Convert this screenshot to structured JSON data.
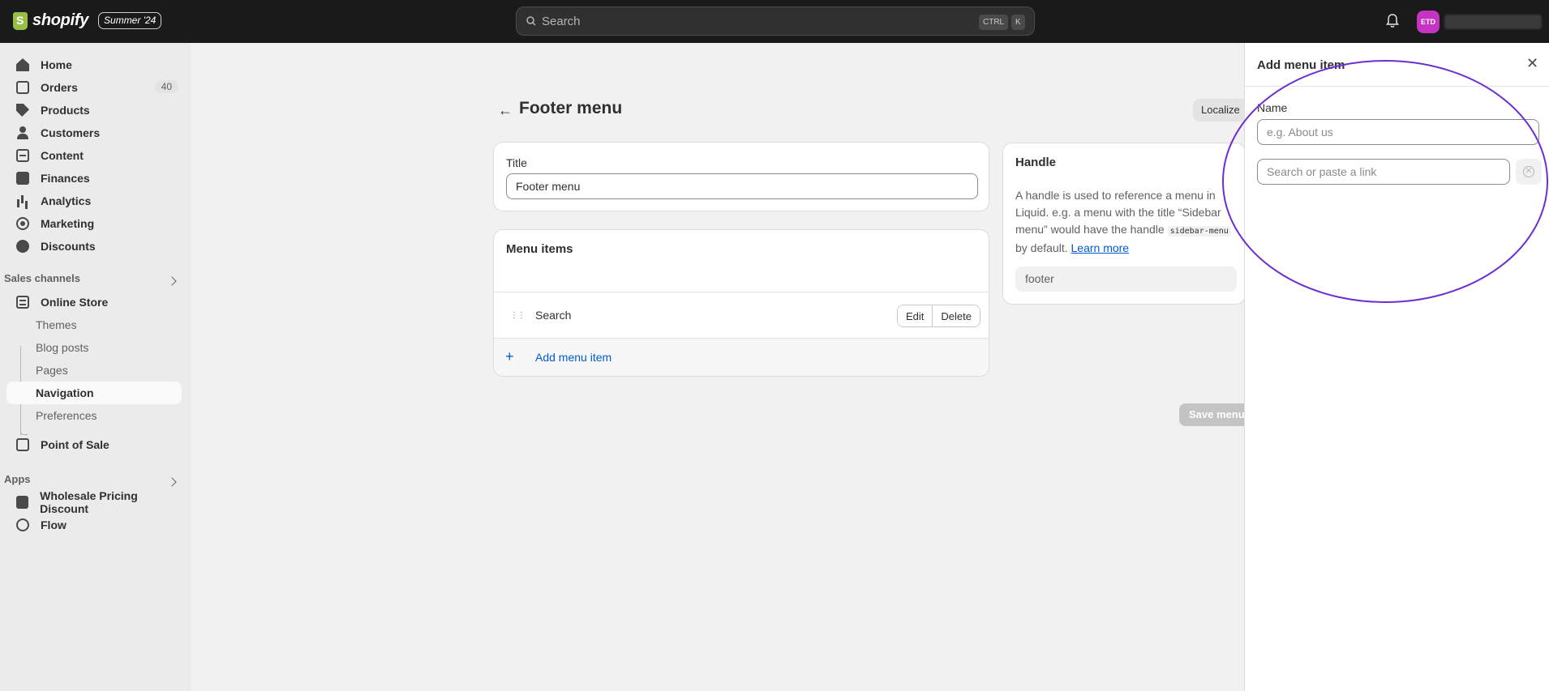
{
  "app": {
    "logo_text": "shopify",
    "edition_badge": "Summer '24"
  },
  "topbar": {
    "search_placeholder": "Search",
    "shortcut_ctrl": "CTRL",
    "shortcut_k": "K",
    "avatar_initials": "ETD"
  },
  "sidebar": {
    "items": [
      {
        "label": "Home",
        "icon": "home-icon"
      },
      {
        "label": "Orders",
        "icon": "orders-icon",
        "count": "40"
      },
      {
        "label": "Products",
        "icon": "tag-icon"
      },
      {
        "label": "Customers",
        "icon": "person-icon"
      },
      {
        "label": "Content",
        "icon": "content-icon"
      },
      {
        "label": "Finances",
        "icon": "finance-icon"
      },
      {
        "label": "Analytics",
        "icon": "analytics-icon"
      },
      {
        "label": "Marketing",
        "icon": "marketing-icon"
      },
      {
        "label": "Discounts",
        "icon": "discount-icon"
      }
    ],
    "sales_channels_label": "Sales channels",
    "online_store": "Online Store",
    "online_store_sub": [
      "Themes",
      "Blog posts",
      "Pages",
      "Navigation",
      "Preferences"
    ],
    "active_sub": "Navigation",
    "point_of_sale": "Point of Sale",
    "apps_label": "Apps",
    "apps": [
      "Wholesale Pricing Discount",
      "Flow"
    ]
  },
  "main": {
    "page_title": "Footer menu",
    "localize_label": "Localize",
    "title_card": {
      "label": "Title",
      "value": "Footer menu"
    },
    "menu_items_card": {
      "heading": "Menu items",
      "items": [
        {
          "label": "Search",
          "edit_label": "Edit",
          "delete_label": "Delete"
        }
      ],
      "add_label": "Add menu item"
    },
    "handle_card": {
      "heading": "Handle",
      "desc_part1": "A handle is used to reference a menu in Liquid. e.g. a menu with the title “Sidebar menu” would have the handle ",
      "desc_code": "sidebar-menu",
      "desc_part2": " by default. ",
      "learn_more": "Learn more",
      "value": "footer"
    },
    "save_label": "Save menu"
  },
  "panel": {
    "title": "Add menu item",
    "name_label": "Name",
    "name_placeholder": "e.g. About us",
    "link_placeholder": "Search or paste a link"
  },
  "colors": {
    "topbar_bg": "#1a1a1a",
    "accent_link": "#005bd3",
    "annotation_stroke": "#6b2fd1",
    "avatar_bg": "#c632c1"
  }
}
